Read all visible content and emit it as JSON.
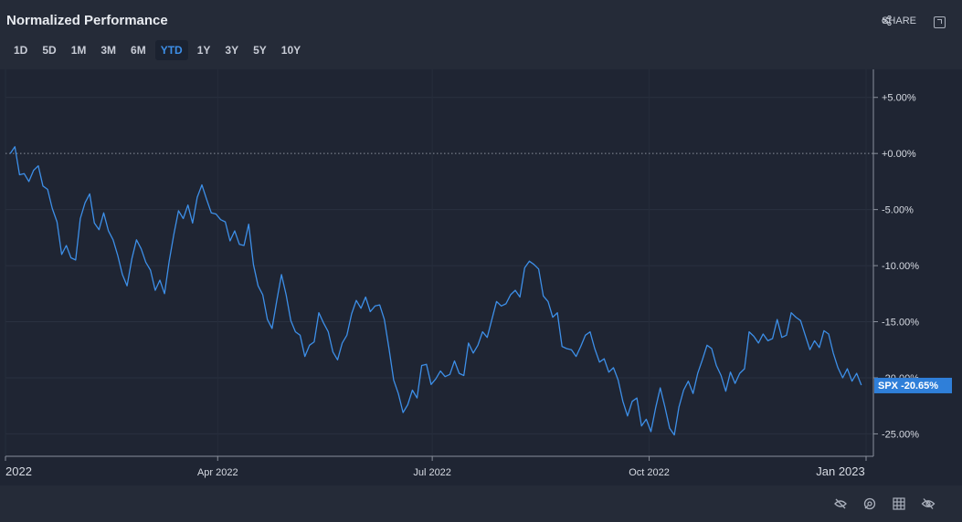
{
  "header": {
    "title": "Normalized Performance",
    "share_label": "SHARE"
  },
  "ranges": [
    "1D",
    "5D",
    "1M",
    "3M",
    "6M",
    "YTD",
    "1Y",
    "3Y",
    "5Y",
    "10Y"
  ],
  "active_range": "YTD",
  "colors": {
    "line": "#3d8fe8",
    "badge": "#2f7fd9",
    "background": "#1f2533"
  },
  "footer_icons": [
    "crosshair-off-icon",
    "comparison-icon",
    "grid-icon",
    "visibility-off-icon"
  ],
  "chart_data": {
    "type": "line",
    "series": [
      {
        "name": "SPX",
        "last_label": "-20.65%",
        "x_start": "2022-01-03",
        "x_end": "2022-12-30",
        "values": [
          0,
          0.6,
          -1.9,
          -1.8,
          -2.5,
          -1.5,
          -1.1,
          -2.9,
          -3.2,
          -4.9,
          -6.1,
          -9,
          -8.2,
          -9.3,
          -9.5,
          -5.8,
          -4.4,
          -3.6,
          -6.2,
          -6.8,
          -5.3,
          -6.9,
          -7.7,
          -9.1,
          -10.8,
          -11.8,
          -9.4,
          -7.7,
          -8.5,
          -9.7,
          -10.4,
          -12.2,
          -11.3,
          -12.5,
          -9.6,
          -7.2,
          -5.1,
          -5.8,
          -4.6,
          -6.2,
          -3.9,
          -2.8,
          -4.1,
          -5.3,
          -5.4,
          -5.9,
          -6.1,
          -7.8,
          -6.9,
          -8.1,
          -8.2,
          -6.3,
          -9.9,
          -11.8,
          -12.6,
          -14.8,
          -15.6,
          -13.1,
          -10.8,
          -12.6,
          -14.9,
          -15.9,
          -16.2,
          -18.1,
          -17.1,
          -16.8,
          -14.2,
          -15.1,
          -15.9,
          -17.7,
          -18.4,
          -16.9,
          -16.2,
          -14.3,
          -13.1,
          -13.8,
          -12.8,
          -14.1,
          -13.6,
          -13.5,
          -14.8,
          -17.4,
          -20.2,
          -21.4,
          -23.1,
          -22.4,
          -21.1,
          -21.8,
          -18.9,
          -18.8,
          -20.6,
          -20.1,
          -19.4,
          -19.9,
          -19.7,
          -18.5,
          -19.6,
          -19.8,
          -16.9,
          -17.8,
          -17.1,
          -15.9,
          -16.4,
          -14.8,
          -13.2,
          -13.6,
          -13.4,
          -12.6,
          -12.2,
          -12.8,
          -10.2,
          -9.6,
          -9.9,
          -10.3,
          -12.7,
          -13.2,
          -14.6,
          -14.2,
          -17.2,
          -17.4,
          -17.5,
          -18.1,
          -17.2,
          -16.2,
          -15.9,
          -17.4,
          -18.6,
          -18.3,
          -19.5,
          -19.1,
          -20.2,
          -22.1,
          -23.4,
          -22.1,
          -21.8,
          -24.3,
          -23.7,
          -24.8,
          -22.7,
          -20.9,
          -22.6,
          -24.5,
          -25.1,
          -22.6,
          -21.1,
          -20.3,
          -21.4,
          -19.6,
          -18.4,
          -17.1,
          -17.4,
          -18.9,
          -19.8,
          -21.2,
          -19.5,
          -20.5,
          -19.6,
          -19.2,
          -15.9,
          -16.3,
          -16.9,
          -16.1,
          -16.7,
          -16.5,
          -14.8,
          -16.4,
          -16.2,
          -14.2,
          -14.6,
          -14.9,
          -16.2,
          -17.5,
          -16.7,
          -17.3,
          -15.8,
          -16.1,
          -17.8,
          -19.1,
          -20,
          -19.2,
          -20.3,
          -19.6,
          -20.65
        ]
      }
    ],
    "x_ticks": [
      "2022",
      "Apr 2022",
      "Jul 2022",
      "Oct 2022",
      "Jan 2023"
    ],
    "y_ticks": [
      "+5.00%",
      "+0.00%",
      "-5.00%",
      "-10.00%",
      "-15.00%",
      "-20.00%",
      "-25.00%"
    ],
    "ylim": [
      -27,
      7.5
    ],
    "zero_line": "dotted",
    "grid": true
  }
}
